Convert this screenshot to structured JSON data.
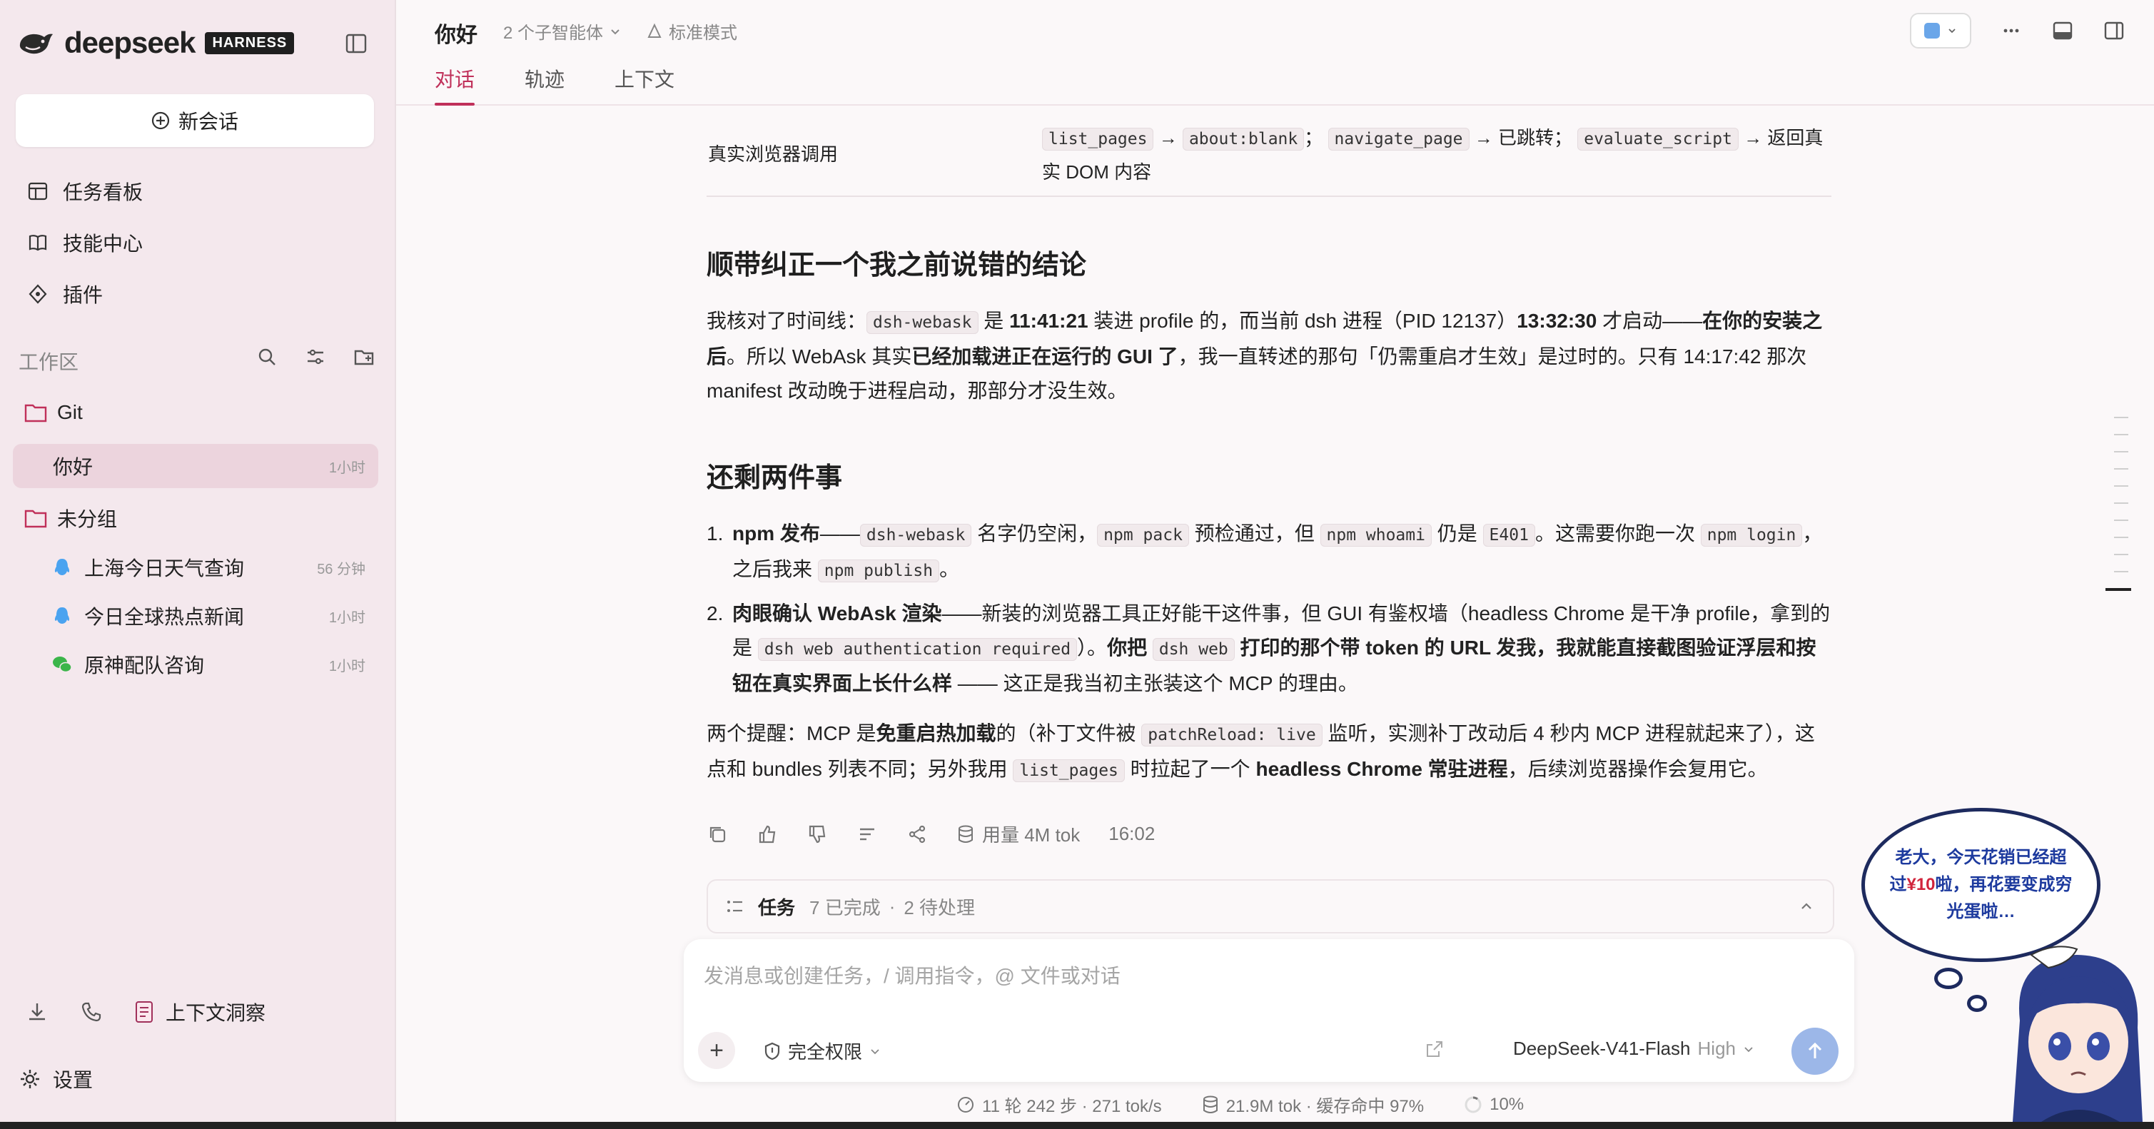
{
  "brand": {
    "name": "deepseek",
    "badge": "HARNESS"
  },
  "sidebar": {
    "new_chat": "新会话",
    "nav": [
      {
        "label": "任务看板",
        "icon": "kanban-icon"
      },
      {
        "label": "技能中心",
        "icon": "book-icon"
      },
      {
        "label": "插件",
        "icon": "plugin-icon"
      }
    ],
    "workspace_label": "工作区",
    "groups": [
      {
        "label": "Git",
        "items": [
          {
            "title": "你好",
            "time": "1小时",
            "active": true
          }
        ]
      },
      {
        "label": "未分组",
        "items": [
          {
            "title": "上海今日天气查询",
            "time": "56 分钟",
            "icon": "qq-icon"
          },
          {
            "title": "今日全球热点新闻",
            "time": "1小时",
            "icon": "qq-icon"
          },
          {
            "title": "原神配队咨询",
            "time": "1小时",
            "icon": "wechat-icon"
          }
        ]
      }
    ],
    "bottom": {
      "insight": "上下文洞察",
      "settings": "设置"
    }
  },
  "header": {
    "title": "你好",
    "agents": "2 个子智能体",
    "mode": "标准模式",
    "tabs": [
      "对话",
      "轨迹",
      "上下文"
    ]
  },
  "content": {
    "table_row": {
      "label": "真实浏览器调用",
      "c1": "list_pages",
      "c2": "about:blank",
      "c3": "navigate_page",
      "t1": "已跳转；",
      "c4": "evaluate_script",
      "t2": "返回真实 DOM 内容"
    },
    "h1": "顺带纠正一个我之前说错的结论",
    "p1": {
      "a": "我核对了时间线：",
      "code": "dsh-webask",
      "b": " 是 ",
      "t1": "11:41:21",
      "c": " 装进 profile 的，而当前 dsh 进程（PID 12137）",
      "t2": "13:32:30",
      "d": " 才启动——",
      "e": "在你的安装之后",
      "f": "。所以 WebAsk 其实",
      "g": "已经加载进正在运行的 GUI 了",
      "h": "，我一直转述的那句「仍需重启才生效」是过时的。只有 14:17:42 那次 manifest 改动晚于进程启动，那部分才没生效。"
    },
    "h2": "还剩两件事",
    "li1": {
      "bold": "npm 发布",
      "a": "——",
      "c1": "dsh-webask",
      "b": " 名字仍空闲，",
      "c2": "npm pack",
      "c": " 预检通过，但 ",
      "c3": "npm whoami",
      "d": " 仍是 ",
      "c4": "E401",
      "e": "。这需要你跑一次 ",
      "c5": "npm login",
      "f": "，之后我来 ",
      "c6": "npm publish",
      "g": "。"
    },
    "li2": {
      "bold": "肉眼确认 WebAsk 渲染",
      "a": "——新装的浏览器工具正好能干这件事，但 GUI 有鉴权墙（headless Chrome 是干净 profile，拿到的是 ",
      "c1": "dsh web authentication required",
      "b": "）。",
      "c": "你把 ",
      "c2": "dsh web",
      "d": " 打印的那个带 token 的 URL 发我，我就能直接截图验证浮层和按钮在真实界面上长什么样",
      "e": " —— 这正是我当初主张装这个 MCP 的理由。"
    },
    "p2": {
      "a": "两个提醒：MCP 是",
      "b": "免重启热加载",
      "c": "的（补丁文件被 ",
      "code1": "patchReload: live",
      "d": " 监听，实测补丁改动后 4 秒内 MCP 进程就起来了），这点和 bundles 列表不同；另外我用 ",
      "code2": "list_pages",
      "e": " 时拉起了一个 ",
      "f": "headless Chrome 常驻进程",
      "g": "，后续浏览器操作会复用它。"
    },
    "usage": "用量 4M tok",
    "time": "16:02"
  },
  "tasks": {
    "label": "任务",
    "done": "7 已完成",
    "sep": "·",
    "pending": "2 待处理"
  },
  "composer": {
    "placeholder": "发消息或创建任务，/ 调用指令，@ 文件或对话",
    "permission": "完全权限",
    "model": "DeepSeek-V41-Flash",
    "effort": "High"
  },
  "statusbar": {
    "turns": "11 轮 242 步 · 271 tok/s",
    "tokens": "21.9M tok · 缓存命中 97%",
    "pct": "10%"
  },
  "mascot": {
    "l1": "老大，今天花销已经超",
    "l2a": "过",
    "amount": "¥10",
    "l2b": "啦，再花要变成穷",
    "l3": "光蛋啦…"
  }
}
